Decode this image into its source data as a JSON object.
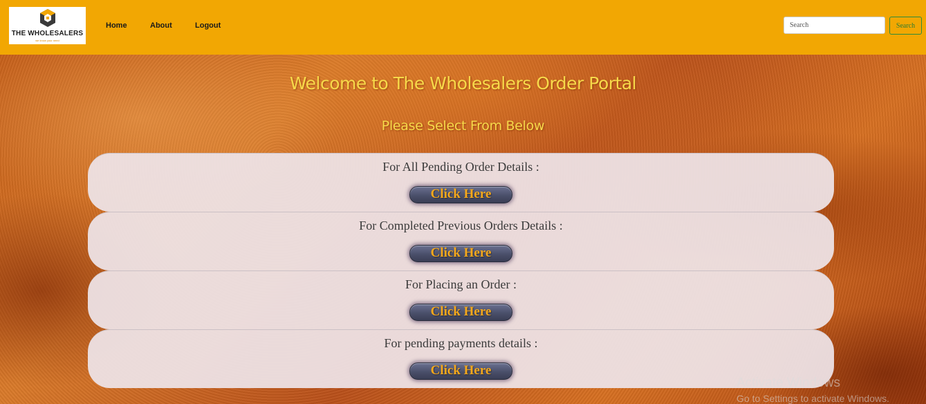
{
  "brand": {
    "name": "THE WHOLESALERS",
    "tagline": "we know your need",
    "colors": {
      "navbar": "#f2a703",
      "accent": "#f5a81c",
      "heading": "#f7d94a"
    }
  },
  "nav": {
    "links": [
      {
        "label": "Home"
      },
      {
        "label": "About"
      },
      {
        "label": "Logout"
      }
    ]
  },
  "search": {
    "placeholder": "Search",
    "button_label": "Search"
  },
  "main": {
    "title": "Welcome to The Wholesalers Order Portal",
    "subtitle": "Please Select From Below",
    "options": [
      {
        "label": "For All Pending Order Details :",
        "button_label": "Click Here"
      },
      {
        "label": "For Completed Previous Orders Details :",
        "button_label": "Click Here"
      },
      {
        "label": "For Placing an Order :",
        "button_label": "Click Here"
      },
      {
        "label": "For pending payments details :",
        "button_label": "Click Here"
      }
    ]
  },
  "watermark": {
    "line1": "Activate Windows",
    "line2": "Go to Settings to activate Windows."
  },
  "icons": {
    "logo": "wholesalers-logo-icon"
  }
}
